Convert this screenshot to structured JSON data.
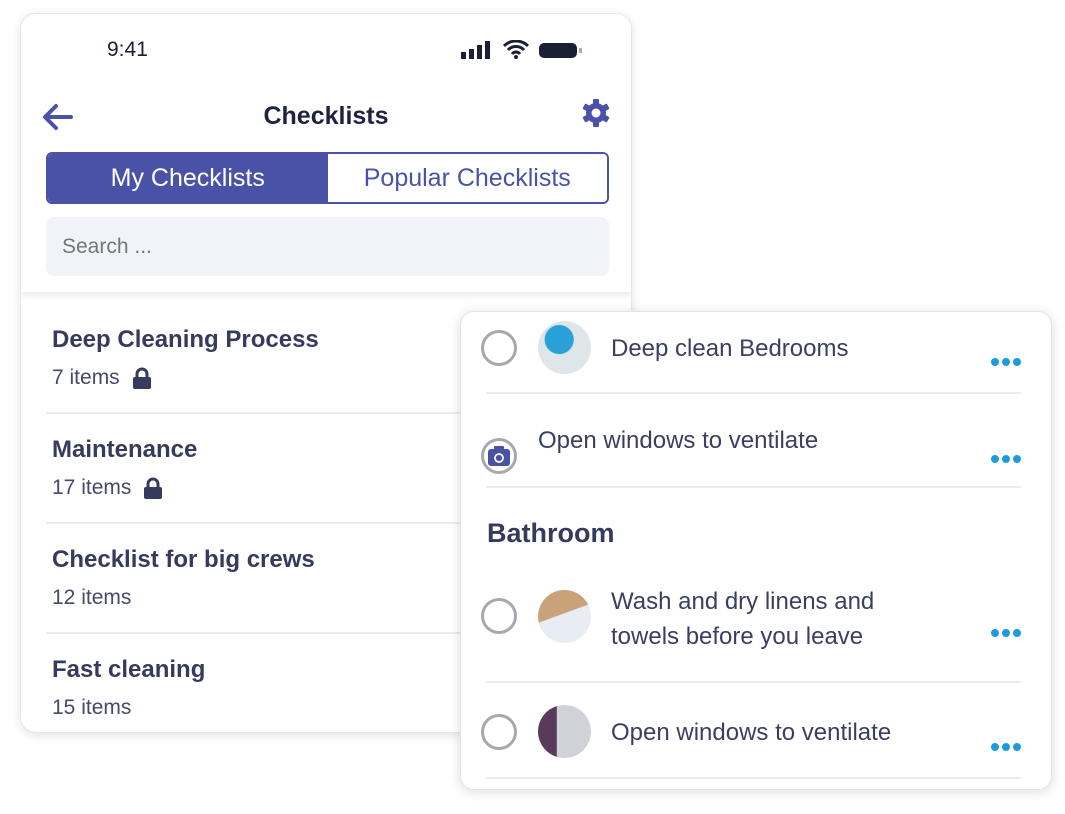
{
  "status": {
    "time": "9:41"
  },
  "header": {
    "title": "Checklists"
  },
  "tabs": [
    {
      "label": "My Checklists",
      "active": true
    },
    {
      "label": "Popular Checklists",
      "active": false
    }
  ],
  "search": {
    "placeholder": "Search ..."
  },
  "checklists": [
    {
      "title": "Deep Cleaning Process",
      "count": "7 items",
      "locked": true
    },
    {
      "title": "Maintenance",
      "count": "17 items",
      "locked": true
    },
    {
      "title": "Checklist for big crews",
      "count": "12 items",
      "locked": false
    },
    {
      "title": "Fast cleaning",
      "count": "15 items",
      "locked": false
    }
  ],
  "detail": {
    "tasks": [
      {
        "label": "Deep clean Bedrooms",
        "icon": "photo-thumbnail"
      },
      {
        "label": "Open windows to ventilate",
        "icon": "camera-icon"
      }
    ],
    "section": "Bathroom",
    "bathroom_tasks": [
      {
        "line1": "Wash and dry linens and",
        "line2": "towels before you leave",
        "icon": "photo-thumbnail"
      },
      {
        "label": "Open windows to ventilate",
        "icon": "photo-thumbnail"
      }
    ]
  },
  "colors": {
    "primary": "#4a52a8",
    "dots": "#1e9be0",
    "text": "#363b5e"
  }
}
